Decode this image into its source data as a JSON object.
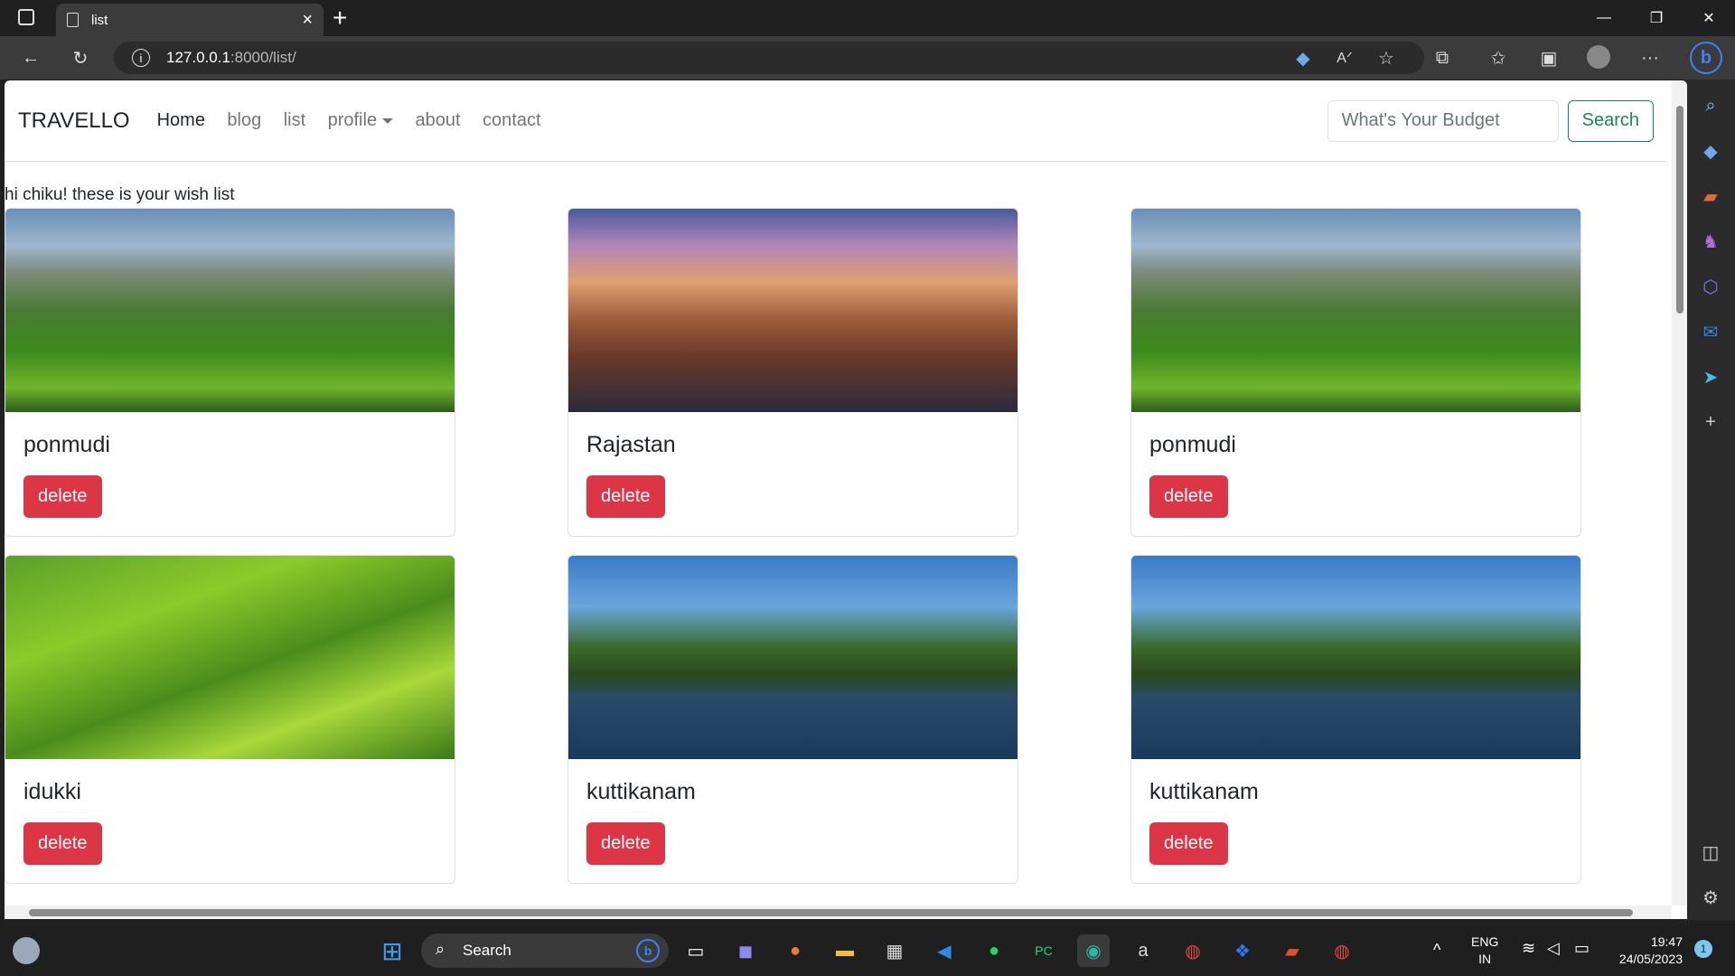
{
  "browser": {
    "tab_title": "list",
    "tab_close": "×",
    "new_tab": "+",
    "address_host": "127.0.0.1",
    "address_path": ":8000/list/",
    "window": {
      "minimize": "—",
      "restore": "❐",
      "close": "✕"
    },
    "more": "···"
  },
  "navbar": {
    "brand": "TRAVELLO",
    "links": [
      {
        "label": "Home"
      },
      {
        "label": "blog"
      },
      {
        "label": "list"
      },
      {
        "label": "profile"
      },
      {
        "label": "about"
      },
      {
        "label": "contact"
      }
    ],
    "search_placeholder": "What's Your Budget",
    "search_button": "Search"
  },
  "greeting": "hi chiku! these is your wish list",
  "cards": [
    {
      "title": "ponmudi",
      "button": "delete",
      "image": "mountain"
    },
    {
      "title": "Rajastan",
      "button": "delete",
      "image": "fort"
    },
    {
      "title": "ponmudi",
      "button": "delete",
      "image": "mountain"
    },
    {
      "title": "idukki",
      "button": "delete",
      "image": "tea"
    },
    {
      "title": "kuttikanam",
      "button": "delete",
      "image": "river"
    },
    {
      "title": "kuttikanam",
      "button": "delete",
      "image": "river"
    }
  ],
  "taskbar": {
    "search_label": "Search",
    "lang_top": "ENG",
    "lang_bottom": "IN",
    "time": "19:47",
    "date": "24/05/2023",
    "notification_count": "1"
  }
}
